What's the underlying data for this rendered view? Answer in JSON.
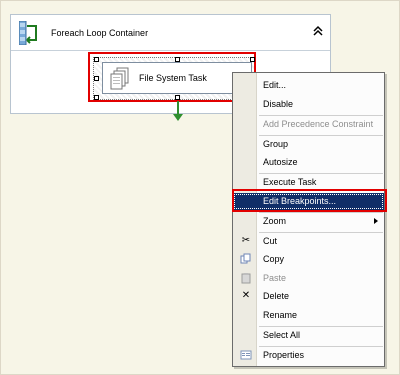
{
  "designer": {
    "container": {
      "title": "Foreach Loop Container",
      "collapse_icon": "double-chevron-up-icon",
      "icon": "foreach-loop-icon"
    },
    "task": {
      "label": "File System Task",
      "icon": "file-system-task-icon"
    },
    "colors": {
      "selection_red": "#E20000",
      "connector_green": "#2F8F2F",
      "highlight_blue": "#102E68"
    }
  },
  "context_menu": {
    "items": [
      {
        "label": "Edit...",
        "enabled": true
      },
      {
        "label": "Disable",
        "enabled": true
      },
      {
        "label": "Add Precedence Constraint",
        "enabled": false
      },
      {
        "label": "Group",
        "enabled": true
      },
      {
        "label": "Autosize",
        "enabled": true
      },
      {
        "label": "Execute Task",
        "enabled": true
      },
      {
        "label": "Edit Breakpoints...",
        "enabled": true,
        "highlighted": true
      },
      {
        "label": "Zoom",
        "enabled": true,
        "has_submenu": true
      },
      {
        "label": "Cut",
        "enabled": true,
        "icon": "scissors-icon"
      },
      {
        "label": "Copy",
        "enabled": true,
        "icon": "copy-icon"
      },
      {
        "label": "Paste",
        "enabled": false,
        "icon": "paste-icon"
      },
      {
        "label": "Delete",
        "enabled": true,
        "icon": "delete-x-icon"
      },
      {
        "label": "Rename",
        "enabled": true
      },
      {
        "label": "Select All",
        "enabled": true
      },
      {
        "label": "Properties",
        "enabled": true,
        "icon": "properties-icon"
      }
    ]
  }
}
